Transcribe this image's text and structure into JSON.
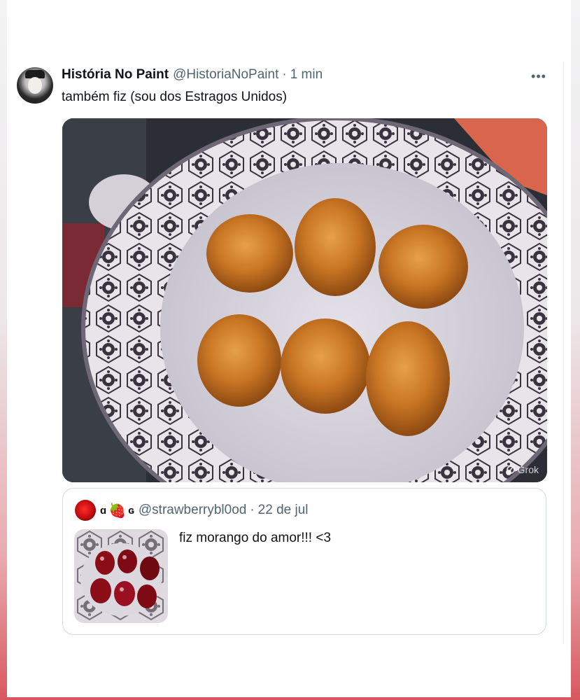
{
  "post": {
    "author_name": "História No Paint",
    "author_handle": "@HistoriaNoPaint",
    "separator": "·",
    "time": "1 min",
    "more_icon": "more-horizontal-icon",
    "text": "também fiz (sou dos Estragos Unidos)",
    "media_badge": "Grok"
  },
  "quoted": {
    "display_name_prefix": "ɑ",
    "display_name_emoji": "🍓",
    "display_name_suffix": "ɢ",
    "handle": "@strawberrybl0od",
    "separator": "·",
    "date": "22 de jul",
    "text": "fiz morango do amor!!! <3"
  },
  "colors": {
    "text_primary": "#0f1419",
    "text_secondary": "#536471",
    "border": "#cfd9de",
    "background_bottom": "#d9575f"
  }
}
